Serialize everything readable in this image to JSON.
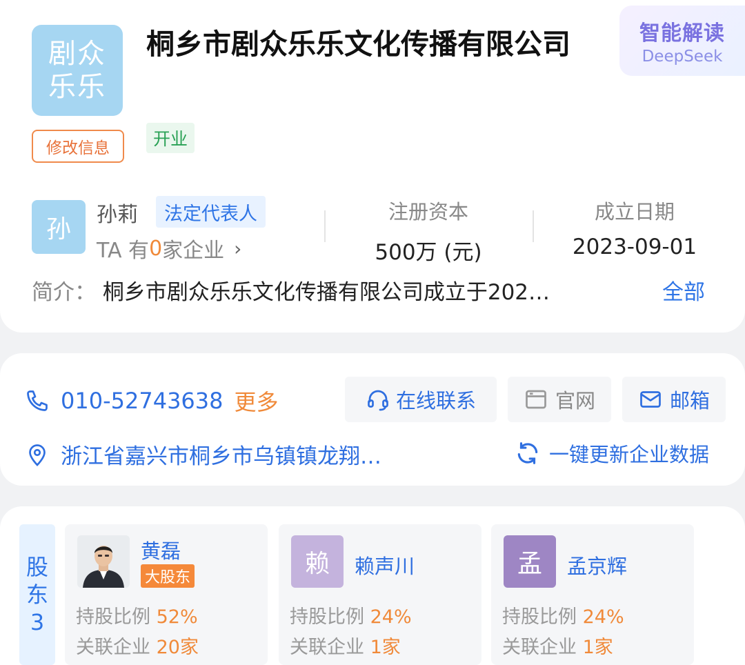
{
  "company": {
    "logo_line1": "剧众",
    "logo_line2": "乐乐",
    "name": "桐乡市剧众乐乐文化传播有限公司",
    "status": "开业",
    "edit_label": "修改信息"
  },
  "ai": {
    "title": "智能解读",
    "subtitle": "DeepSeek"
  },
  "legal_rep": {
    "avatar_char": "孙",
    "name": "孙莉",
    "tag": "法定代表人",
    "count_prefix": "TA 有 ",
    "count_value": "0",
    "count_suffix": " 家企业",
    "chevron": "›"
  },
  "stats": {
    "capital_label": "注册资本",
    "capital_value": "500万 (元)",
    "date_label": "成立日期",
    "date_value": "2023-09-01"
  },
  "intro": {
    "label": "简介：",
    "text": "桐乡市剧众乐乐文化传播有限公司成立于202…",
    "more": "全部"
  },
  "contact": {
    "phone": "010-52743638",
    "phone_more": "更多",
    "online_label": "在线联系",
    "website_label": "官网",
    "email_label": "邮箱",
    "address": "浙江省嘉兴市桐乡市乌镇镇龙翔…",
    "refresh_label": "一键更新企业数据"
  },
  "shareholders": {
    "label_line1": "股",
    "label_line2": "东",
    "label_count": "3",
    "ratio_label": "持股比例",
    "related_label": "关联企业",
    "items": [
      {
        "name": "黄磊",
        "badge": "大股东",
        "ratio": "52%",
        "related": "20家",
        "avatar_char": ""
      },
      {
        "name": "赖声川",
        "badge": "",
        "ratio": "24%",
        "related": "1家",
        "avatar_char": "赖"
      },
      {
        "name": "孟京辉",
        "badge": "",
        "ratio": "24%",
        "related": "1家",
        "avatar_char": "孟"
      }
    ]
  },
  "colors": {
    "accent_blue": "#2f75e6",
    "accent_orange": "#f08a3a",
    "status_green": "#29a155",
    "logo_blue": "#a6d6f2",
    "avatar_purple": "#c4b3dd",
    "avatar_purple_dark": "#9e86c4"
  }
}
